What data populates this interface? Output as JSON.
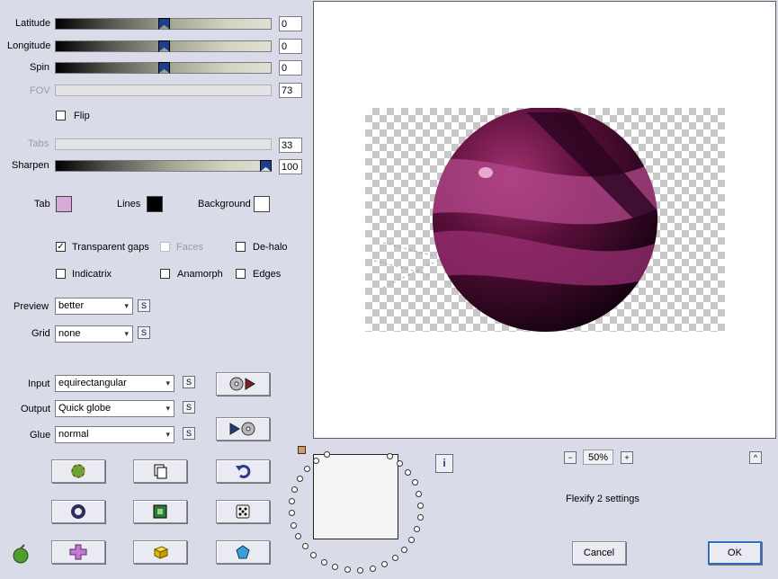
{
  "sliders": {
    "latitude": {
      "label": "Latitude",
      "value": "0",
      "fraction": 0.5
    },
    "longitude": {
      "label": "Longitude",
      "value": "0",
      "fraction": 0.5
    },
    "spin": {
      "label": "Spin",
      "value": "0",
      "fraction": 0.5
    },
    "fov": {
      "label": "FOV",
      "value": "73"
    },
    "tabs": {
      "label": "Tabs",
      "value": "33"
    },
    "sharpen": {
      "label": "Sharpen",
      "value": "100",
      "fraction": 1.0
    }
  },
  "flip": {
    "label": "Flip",
    "checked": false
  },
  "colors": {
    "tab": {
      "label": "Tab",
      "color": "#d9a9d9"
    },
    "lines": {
      "label": "Lines",
      "color": "#000000"
    },
    "background": {
      "label": "Background",
      "color": "#ffffff"
    }
  },
  "options": {
    "transparent_gaps": {
      "label": "Transparent gaps",
      "checked": true
    },
    "faces": {
      "label": "Faces",
      "checked": false
    },
    "de_halo": {
      "label": "De-halo",
      "checked": false
    },
    "indicatrix": {
      "label": "Indicatrix",
      "checked": false
    },
    "anamorph": {
      "label": "Anamorph",
      "checked": false
    },
    "edges": {
      "label": "Edges",
      "checked": false
    }
  },
  "selects": {
    "preview": {
      "label": "Preview",
      "value": "better"
    },
    "grid": {
      "label": "Grid",
      "value": "none"
    },
    "input": {
      "label": "Input",
      "value": "equirectangular"
    },
    "output": {
      "label": "Output",
      "value": "Quick globe"
    },
    "glue": {
      "label": "Glue",
      "value": "normal"
    }
  },
  "small_button_glyph": "S",
  "zoom": {
    "value": "50%",
    "minus": "−",
    "plus": "+"
  },
  "collapse_glyph": "^",
  "info_glyph": "i",
  "settings_name": "Flexify 2 settings",
  "buttons": {
    "cancel": "Cancel",
    "ok": "OK"
  },
  "accent": "#2f6fbf"
}
